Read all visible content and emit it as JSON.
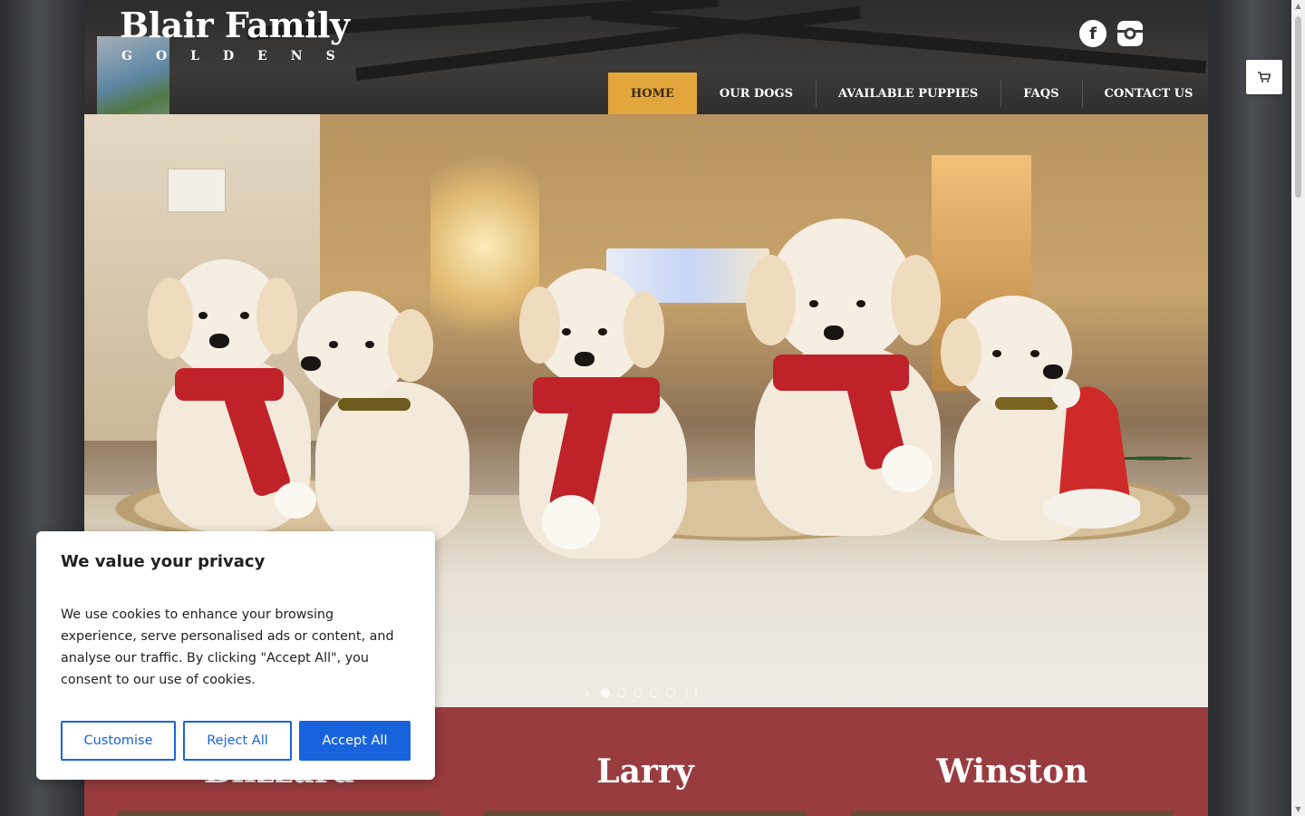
{
  "site": {
    "title": "Blair Family",
    "subtitle": "GOLDENS"
  },
  "social": {
    "facebook_glyph": "f",
    "icons": [
      "facebook-icon",
      "instagram-icon"
    ]
  },
  "nav": {
    "items": [
      {
        "label": "HOME",
        "active": true
      },
      {
        "label": "OUR DOGS",
        "active": false
      },
      {
        "label": "AVAILABLE PUPPIES",
        "active": false
      },
      {
        "label": "FAQS",
        "active": false
      },
      {
        "label": "CONTACT US",
        "active": false
      }
    ]
  },
  "slider": {
    "slide_count": 5,
    "active_index": 0,
    "next_glyph": "›",
    "pause_glyph": "❙❙"
  },
  "dogs": {
    "names": [
      "Blizzard",
      "Larry",
      "Winston"
    ]
  },
  "cart": {
    "glyph": "🛒"
  },
  "cookie": {
    "title": "We value your privacy",
    "body": "We use cookies to enhance your browsing experience, serve personalised ads or content, and analyse our traffic. By clicking \"Accept All\", you consent to our use of cookies.",
    "customise_label": "Customise",
    "reject_label": "Reject All",
    "accept_label": "Accept All"
  },
  "scrollbar": {
    "up_glyph": "▲",
    "down_glyph": "▼"
  },
  "colors": {
    "nav_active": "#e3a63c",
    "band": "#993c40",
    "cookie_accent": "#1863dc"
  }
}
